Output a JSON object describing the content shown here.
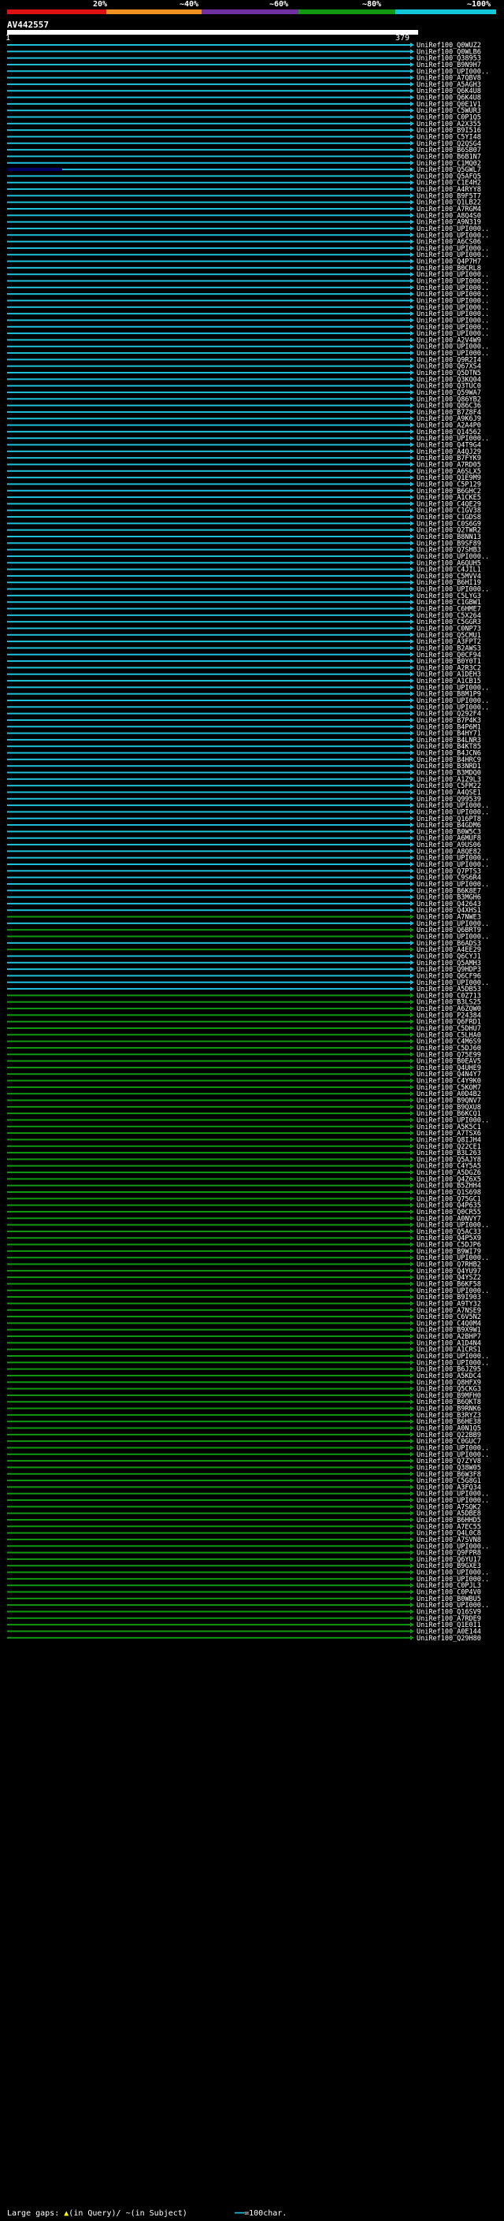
{
  "header": {
    "pct_labels": [
      "20%",
      "~40%",
      "~60%",
      "~80%",
      "~100%"
    ],
    "color_scale": [
      "#dd1111",
      "#f09020",
      "#7030a0",
      "#119911",
      "#10c8d8"
    ]
  },
  "query": {
    "title": "AV442557",
    "start": "1",
    "end": "379"
  },
  "hits": [
    {
      "label": "UniRef100_Q0WUZ2",
      "color": "blue"
    },
    {
      "label": "UniRef100_Q0WLB6",
      "color": "blue"
    },
    {
      "label": "UniRef100_Q38953",
      "color": "blue"
    },
    {
      "label": "UniRef100_B9N9H7",
      "color": "blue"
    },
    {
      "label": "UniRef100_UPI000..",
      "color": "blue"
    },
    {
      "label": "UniRef100_A7QBV8",
      "color": "blue"
    },
    {
      "label": "UniRef100_A5AGH3",
      "color": "blue"
    },
    {
      "label": "UniRef100_Q6K4U8",
      "color": "blue"
    },
    {
      "label": "UniRef100_Q6K4U8",
      "color": "blue"
    },
    {
      "label": "UniRef100_Q0E1V1",
      "color": "blue"
    },
    {
      "label": "UniRef100_C5WUR3",
      "color": "blue"
    },
    {
      "label": "UniRef100_C0P1Q5",
      "color": "blue"
    },
    {
      "label": "UniRef100_A2X355",
      "color": "blue"
    },
    {
      "label": "UniRef100_B9I516",
      "color": "blue"
    },
    {
      "label": "UniRef100_C5YI48",
      "color": "blue"
    },
    {
      "label": "UniRef100_Q2QSG4",
      "color": "blue"
    },
    {
      "label": "UniRef100_B6SB07",
      "color": "blue"
    },
    {
      "label": "UniRef100_B6B1N7",
      "color": "blue"
    },
    {
      "label": "UniRef100_C1MQ02",
      "color": "blue"
    },
    {
      "label": "UniRef100_Q5GWL7",
      "color": "blue",
      "dark": true
    },
    {
      "label": "UniRef100_Q5AFQ5",
      "color": "blue"
    },
    {
      "label": "UniRef100_C1E4H2",
      "color": "blue"
    },
    {
      "label": "UniRef100_A4RYY8",
      "color": "blue"
    },
    {
      "label": "UniRef100_B9F5T7",
      "color": "blue"
    },
    {
      "label": "UniRef100_Q1LB22",
      "color": "blue"
    },
    {
      "label": "UniRef100_A7RGM4",
      "color": "blue"
    },
    {
      "label": "UniRef100_A8Q4S0",
      "color": "blue"
    },
    {
      "label": "UniRef100_A9N319",
      "color": "blue"
    },
    {
      "label": "UniRef100_UPI000..",
      "color": "blue"
    },
    {
      "label": "UniRef100_UPI000..",
      "color": "blue"
    },
    {
      "label": "UniRef100_A6CS06",
      "color": "blue"
    },
    {
      "label": "UniRef100_UPI000..",
      "color": "blue"
    },
    {
      "label": "UniRef100_UPI000..",
      "color": "blue"
    },
    {
      "label": "UniRef100_Q4P7H7",
      "color": "blue"
    },
    {
      "label": "UniRef100_B0CRL8",
      "color": "blue"
    },
    {
      "label": "UniRef100_UPI000..",
      "color": "blue"
    },
    {
      "label": "UniRef100_UPI000..",
      "color": "blue"
    },
    {
      "label": "UniRef100_UPI000..",
      "color": "blue"
    },
    {
      "label": "UniRef100_UPI000..",
      "color": "blue"
    },
    {
      "label": "UniRef100_UPI000..",
      "color": "blue"
    },
    {
      "label": "UniRef100_UPI000..",
      "color": "blue"
    },
    {
      "label": "UniRef100_UPI000..",
      "color": "blue"
    },
    {
      "label": "UniRef100_UPI000..",
      "color": "blue"
    },
    {
      "label": "UniRef100_UPI000..",
      "color": "blue"
    },
    {
      "label": "UniRef100_UPI000..",
      "color": "blue"
    },
    {
      "label": "UniRef100_A2V4W9",
      "color": "blue"
    },
    {
      "label": "UniRef100_UPI000..",
      "color": "blue"
    },
    {
      "label": "UniRef100_UPI000..",
      "color": "blue"
    },
    {
      "label": "UniRef100_Q9R2I4",
      "color": "blue"
    },
    {
      "label": "UniRef100_Q67XS4",
      "color": "blue"
    },
    {
      "label": "UniRef100_Q5DTN5",
      "color": "blue"
    },
    {
      "label": "UniRef100_Q3KQ04",
      "color": "blue"
    },
    {
      "label": "UniRef100_Q3TUC0",
      "color": "blue"
    },
    {
      "label": "UniRef100_Q59WA7",
      "color": "blue"
    },
    {
      "label": "UniRef100_Q86YB2",
      "color": "blue"
    },
    {
      "label": "UniRef100_Q86C36",
      "color": "blue"
    },
    {
      "label": "UniRef100_B7Z8F4",
      "color": "blue"
    },
    {
      "label": "UniRef100_A9K6J9",
      "color": "blue"
    },
    {
      "label": "UniRef100_A2A4P0",
      "color": "blue"
    },
    {
      "label": "UniRef100_Q14562",
      "color": "blue"
    },
    {
      "label": "UniRef100_UPI000..",
      "color": "blue"
    },
    {
      "label": "UniRef100_Q4T9G4",
      "color": "blue"
    },
    {
      "label": "UniRef100_A4QJ29",
      "color": "blue"
    },
    {
      "label": "UniRef100_B7FYK9",
      "color": "blue"
    },
    {
      "label": "UniRef100_A7RD05",
      "color": "blue"
    },
    {
      "label": "UniRef100_A6SLX5",
      "color": "blue"
    },
    {
      "label": "UniRef100_Q1E9M9",
      "color": "blue"
    },
    {
      "label": "UniRef100_C5P129",
      "color": "blue"
    },
    {
      "label": "UniRef100_B6GHC2",
      "color": "blue"
    },
    {
      "label": "UniRef100_A1CKE5",
      "color": "blue"
    },
    {
      "label": "UniRef100_C4QE29",
      "color": "blue"
    },
    {
      "label": "UniRef100_C1GV38",
      "color": "blue"
    },
    {
      "label": "UniRef100_C1GDS8",
      "color": "blue"
    },
    {
      "label": "UniRef100_C0S6G9",
      "color": "blue"
    },
    {
      "label": "UniRef100_Q2TWR2",
      "color": "blue"
    },
    {
      "label": "UniRef100_B8NN13",
      "color": "blue"
    },
    {
      "label": "UniRef100_B9SF89",
      "color": "blue"
    },
    {
      "label": "UniRef100_Q7SHB3",
      "color": "blue"
    },
    {
      "label": "UniRef100_UPI000..",
      "color": "blue"
    },
    {
      "label": "UniRef100_A6QUH5",
      "color": "blue"
    },
    {
      "label": "UniRef100_C4JIL1",
      "color": "blue"
    },
    {
      "label": "UniRef100_C5MVV4",
      "color": "blue"
    },
    {
      "label": "UniRef100_B6HI19",
      "color": "blue"
    },
    {
      "label": "UniRef100_UPI000..",
      "color": "blue"
    },
    {
      "label": "UniRef100_C5LYG3",
      "color": "blue"
    },
    {
      "label": "UniRef100_C1GBW1",
      "color": "blue"
    },
    {
      "label": "UniRef100_C6HME7",
      "color": "blue"
    },
    {
      "label": "UniRef100_C5X264",
      "color": "blue"
    },
    {
      "label": "UniRef100_C5GGR3",
      "color": "blue"
    },
    {
      "label": "UniRef100_C0NP73",
      "color": "blue"
    },
    {
      "label": "UniRef100_Q5CMU1",
      "color": "blue"
    },
    {
      "label": "UniRef100_A3FPT2",
      "color": "blue"
    },
    {
      "label": "UniRef100_B2AWS3",
      "color": "blue"
    },
    {
      "label": "UniRef100_Q0CF94",
      "color": "blue"
    },
    {
      "label": "UniRef100_B0Y0T1",
      "color": "blue"
    },
    {
      "label": "UniRef100_A2R3C2",
      "color": "blue"
    },
    {
      "label": "UniRef100_A1DEH3",
      "color": "blue"
    },
    {
      "label": "UniRef100_A1CB15",
      "color": "blue"
    },
    {
      "label": "UniRef100_UPI000..",
      "color": "blue"
    },
    {
      "label": "UniRef100_B8M1P9",
      "color": "blue"
    },
    {
      "label": "UniRef100_UPI000..",
      "color": "blue"
    },
    {
      "label": "UniRef100_UPI000..",
      "color": "blue"
    },
    {
      "label": "UniRef100_Q292F4",
      "color": "blue"
    },
    {
      "label": "UniRef100_B7P4K3",
      "color": "blue"
    },
    {
      "label": "UniRef100_B4P6M1",
      "color": "blue"
    },
    {
      "label": "UniRef100_B4HY71",
      "color": "blue"
    },
    {
      "label": "UniRef100_B4LNR3",
      "color": "blue"
    },
    {
      "label": "UniRef100_B4KT85",
      "color": "blue"
    },
    {
      "label": "UniRef100_B4JCN6",
      "color": "blue"
    },
    {
      "label": "UniRef100_B4HRC9",
      "color": "blue"
    },
    {
      "label": "UniRef100_B3NRD1",
      "color": "blue"
    },
    {
      "label": "UniRef100_B3MDQ0",
      "color": "blue"
    },
    {
      "label": "UniRef100_A1Z9L3",
      "color": "blue"
    },
    {
      "label": "UniRef100_C5FM22",
      "color": "blue"
    },
    {
      "label": "UniRef100_A4QSE1",
      "color": "blue"
    },
    {
      "label": "UniRef100_Q99539",
      "color": "blue"
    },
    {
      "label": "UniRef100_UPI000..",
      "color": "blue"
    },
    {
      "label": "UniRef100_UPI000..",
      "color": "blue"
    },
    {
      "label": "UniRef100_Q16PT8",
      "color": "blue"
    },
    {
      "label": "UniRef100_B4GDM6",
      "color": "blue"
    },
    {
      "label": "UniRef100_B0W5C3",
      "color": "blue"
    },
    {
      "label": "UniRef100_A6MUF8",
      "color": "blue"
    },
    {
      "label": "UniRef100_A9US06",
      "color": "blue"
    },
    {
      "label": "UniRef100_A8QE82",
      "color": "blue"
    },
    {
      "label": "UniRef100_UPI000..",
      "color": "blue"
    },
    {
      "label": "UniRef100_UPI000..",
      "color": "blue"
    },
    {
      "label": "UniRef100_Q7PTS3",
      "color": "blue"
    },
    {
      "label": "UniRef100_C9S6R4",
      "color": "blue"
    },
    {
      "label": "UniRef100_UPI000..",
      "color": "blue"
    },
    {
      "label": "UniRef100_B6K8E7",
      "color": "blue"
    },
    {
      "label": "UniRef100_B3MGH6",
      "color": "blue"
    },
    {
      "label": "UniRef100_Q42643",
      "color": "blue"
    },
    {
      "label": "UniRef100_Q4XHS1",
      "color": "blue"
    },
    {
      "label": "UniRef100_A7NWE3",
      "color": "green"
    },
    {
      "label": "UniRef100_UPI000..",
      "color": "blue"
    },
    {
      "label": "UniRef100_Q6BRT9",
      "color": "green"
    },
    {
      "label": "UniRef100_UPI000..",
      "color": "green"
    },
    {
      "label": "UniRef100_B6ADS3",
      "color": "blue"
    },
    {
      "label": "UniRef100_A4EE29",
      "color": "green"
    },
    {
      "label": "UniRef100_Q6CYJ1",
      "color": "blue"
    },
    {
      "label": "UniRef100_Q5AMH3",
      "color": "blue"
    },
    {
      "label": "UniRef100_Q9HDP3",
      "color": "blue"
    },
    {
      "label": "UniRef100_Q6CF96",
      "color": "blue"
    },
    {
      "label": "UniRef100_UPI000..",
      "color": "blue"
    },
    {
      "label": "UniRef100_A5DB53",
      "color": "blue"
    },
    {
      "label": "UniRef100_C0Z713",
      "color": "green"
    },
    {
      "label": "UniRef100_B3LS25",
      "color": "green"
    },
    {
      "label": "UniRef100_A6ZQW0",
      "color": "green"
    },
    {
      "label": "UniRef100_P24384",
      "color": "green"
    },
    {
      "label": "UniRef100_Q6FRD1",
      "color": "green"
    },
    {
      "label": "UniRef100_C5DHU7",
      "color": "green"
    },
    {
      "label": "UniRef100_C5LHA0",
      "color": "green"
    },
    {
      "label": "UniRef100_C4M6S9",
      "color": "green"
    },
    {
      "label": "UniRef100_C5DJ60",
      "color": "green"
    },
    {
      "label": "UniRef100_Q75E99",
      "color": "green"
    },
    {
      "label": "UniRef100_B0EAV5",
      "color": "green"
    },
    {
      "label": "UniRef100_Q4UHE9",
      "color": "green"
    },
    {
      "label": "UniRef100_Q4N4Y7",
      "color": "green"
    },
    {
      "label": "UniRef100_C4Y9K0",
      "color": "green"
    },
    {
      "label": "UniRef100_C5KOM7",
      "color": "green"
    },
    {
      "label": "UniRef100_A0D4B2",
      "color": "green"
    },
    {
      "label": "UniRef100_B9QNV7",
      "color": "green"
    },
    {
      "label": "UniRef100_B9QXU8",
      "color": "green"
    },
    {
      "label": "UniRef100_B6KCQ1",
      "color": "green"
    },
    {
      "label": "UniRef100_UPI000..",
      "color": "green"
    },
    {
      "label": "UniRef100_A5K5C1",
      "color": "green"
    },
    {
      "label": "UniRef100_A7TSX6",
      "color": "green"
    },
    {
      "label": "UniRef100_Q8IJH4",
      "color": "green"
    },
    {
      "label": "UniRef100_Q22CE1",
      "color": "green"
    },
    {
      "label": "UniRef100_B3L263",
      "color": "green"
    },
    {
      "label": "UniRef100_Q5AJY8",
      "color": "green"
    },
    {
      "label": "UniRef100_C4Y5A5",
      "color": "green"
    },
    {
      "label": "UniRef100_A5DGZ6",
      "color": "green"
    },
    {
      "label": "UniRef100_Q4Z6X5",
      "color": "green"
    },
    {
      "label": "UniRef100_B5ZHH4",
      "color": "green"
    },
    {
      "label": "UniRef100_Q1S698",
      "color": "green"
    },
    {
      "label": "UniRef100_Q75GC1",
      "color": "green"
    },
    {
      "label": "UniRef100_Q4P635",
      "color": "green"
    },
    {
      "label": "UniRef100_Q0CR55",
      "color": "green"
    },
    {
      "label": "UniRef100_A0NVY7",
      "color": "green"
    },
    {
      "label": "UniRef100_UPI000..",
      "color": "green"
    },
    {
      "label": "UniRef100_Q5AC33",
      "color": "green"
    },
    {
      "label": "UniRef100_Q4P5X9",
      "color": "green"
    },
    {
      "label": "UniRef100_C5DJP6",
      "color": "green"
    },
    {
      "label": "UniRef100_B9WI79",
      "color": "green"
    },
    {
      "label": "UniRef100_UPI000..",
      "color": "green"
    },
    {
      "label": "UniRef100_Q7RHB2",
      "color": "green"
    },
    {
      "label": "UniRef100_Q4YU97",
      "color": "green"
    },
    {
      "label": "UniRef100_Q4YSZ2",
      "color": "green"
    },
    {
      "label": "UniRef100_B6KF58",
      "color": "green"
    },
    {
      "label": "UniRef100_UPI000..",
      "color": "green"
    },
    {
      "label": "UniRef100_B9I903",
      "color": "green"
    },
    {
      "label": "UniRef100_A9TY32",
      "color": "green"
    },
    {
      "label": "UniRef100_A7NSE9",
      "color": "green"
    },
    {
      "label": "UniRef100_C6V5N2",
      "color": "green"
    },
    {
      "label": "UniRef100_C4Q0M4",
      "color": "green"
    },
    {
      "label": "UniRef100_B9X9W1",
      "color": "green"
    },
    {
      "label": "UniRef100_A2BHP7",
      "color": "green"
    },
    {
      "label": "UniRef100_A1D4N4",
      "color": "green"
    },
    {
      "label": "UniRef100_A1CRS1",
      "color": "green"
    },
    {
      "label": "UniRef100_UPI000..",
      "color": "green"
    },
    {
      "label": "UniRef100_UPI000..",
      "color": "green"
    },
    {
      "label": "UniRef100_B6JZ95",
      "color": "green"
    },
    {
      "label": "UniRef100_A5KDC4",
      "color": "green"
    },
    {
      "label": "UniRef100_Q8HFX9",
      "color": "green"
    },
    {
      "label": "UniRef100_Q5CKG3",
      "color": "green"
    },
    {
      "label": "UniRef100_B9MFH0",
      "color": "green"
    },
    {
      "label": "UniRef100_B6QKT8",
      "color": "green"
    },
    {
      "label": "UniRef100_B9RNK6",
      "color": "green"
    },
    {
      "label": "UniRef100_B3RYZ3",
      "color": "green"
    },
    {
      "label": "UniRef100_B6HE38",
      "color": "green"
    },
    {
      "label": "UniRef100_A0N1Q5",
      "color": "green"
    },
    {
      "label": "UniRef100_Q22BB9",
      "color": "green"
    },
    {
      "label": "UniRef100_C0GUC7",
      "color": "green"
    },
    {
      "label": "UniRef100_UPI000..",
      "color": "green"
    },
    {
      "label": "UniRef100_UPI000..",
      "color": "green"
    },
    {
      "label": "UniRef100_Q7ZYV8",
      "color": "green"
    },
    {
      "label": "UniRef100_Q38W05",
      "color": "green"
    },
    {
      "label": "UniRef100_B6W3F8",
      "color": "green"
    },
    {
      "label": "UniRef100_C5G8G1",
      "color": "green"
    },
    {
      "label": "UniRef100_A3FQ34",
      "color": "green"
    },
    {
      "label": "UniRef100_UPI000..",
      "color": "green"
    },
    {
      "label": "UniRef100_UPI000..",
      "color": "green"
    },
    {
      "label": "UniRef100_A7SQK2",
      "color": "green"
    },
    {
      "label": "UniRef100_A5DBE8",
      "color": "green"
    },
    {
      "label": "UniRef100_B6HHD5",
      "color": "green"
    },
    {
      "label": "UniRef100_A7EC55",
      "color": "green"
    },
    {
      "label": "UniRef100_Q4L0C8",
      "color": "green"
    },
    {
      "label": "UniRef100_A7SVN8",
      "color": "green"
    },
    {
      "label": "UniRef100_UPI000..",
      "color": "green"
    },
    {
      "label": "UniRef100_Q9FPR8",
      "color": "green"
    },
    {
      "label": "UniRef100_Q6YU17",
      "color": "green"
    },
    {
      "label": "UniRef100_B9GXE3",
      "color": "green"
    },
    {
      "label": "UniRef100_UPI000..",
      "color": "green"
    },
    {
      "label": "UniRef100_UPI000..",
      "color": "green"
    },
    {
      "label": "UniRef100_C0PJL3",
      "color": "green"
    },
    {
      "label": "UniRef100_C0P4V0",
      "color": "green"
    },
    {
      "label": "UniRef100_B0WBU5",
      "color": "green"
    },
    {
      "label": "UniRef100_UPI000..",
      "color": "green"
    },
    {
      "label": "UniRef100_Q16SV9",
      "color": "green"
    },
    {
      "label": "UniRef100_A7RDE9",
      "color": "green"
    },
    {
      "label": "UniRef100_Q1E0I1",
      "color": "green"
    },
    {
      "label": "UniRef100_A0E144",
      "color": "green"
    },
    {
      "label": "UniRef100_Q29H80",
      "color": "green"
    }
  ],
  "footer": {
    "gaps_label": "Large gaps:",
    "in_query": "(in Query)/",
    "in_subject": "~(in Subject)",
    "scale_label": "=100char."
  }
}
